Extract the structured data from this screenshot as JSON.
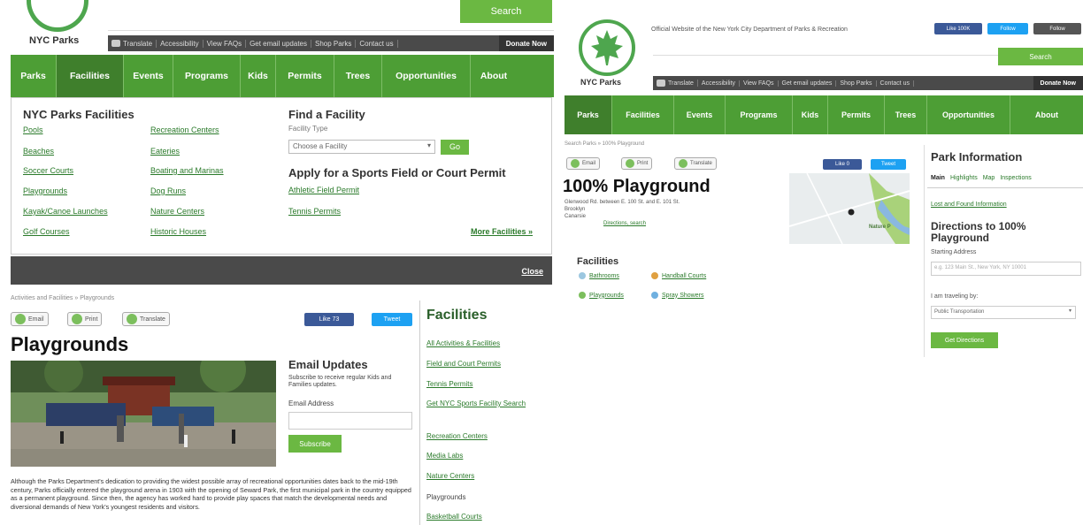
{
  "left": {
    "logo_text": "NYC Parks",
    "search_label": "Search",
    "util": {
      "translate": "Translate",
      "items": [
        "Accessibility",
        "View FAQs",
        "Get email updates",
        "Shop Parks",
        "Contact us"
      ],
      "donate": "Donate Now"
    },
    "nav": [
      "Parks",
      "Facilities",
      "Events",
      "Programs",
      "Kids",
      "Permits",
      "Trees",
      "Opportunities",
      "About"
    ],
    "dropdown": {
      "title": "NYC Parks Facilities",
      "col1": [
        "Pools",
        "Beaches",
        "Soccer Courts",
        "Playgrounds",
        "Kayak/Canoe Launches",
        "Golf Courses"
      ],
      "col2": [
        "Recreation Centers",
        "Eateries",
        "Boating and Marinas",
        "Dog Runs",
        "Nature Centers",
        "Historic Houses"
      ],
      "find_title": "Find a Facility",
      "facility_type_label": "Facility Type",
      "select_placeholder": "Choose a Facility",
      "go": "Go",
      "permit_title": "Apply for a Sports Field or Court Permit",
      "permit_links": [
        "Athletic Field Permit",
        "Tennis Permits"
      ],
      "more": "More Facilities »",
      "close": "Close"
    },
    "breadcrumb": "Activities and Facilities » Playgrounds",
    "share": {
      "email": "Email",
      "print": "Print",
      "translate": "Translate"
    },
    "like": "Like 73",
    "tweet": "Tweet",
    "page_title": "Playgrounds",
    "email_updates": {
      "title": "Email Updates",
      "desc": "Subscribe to receive regular Kids and Families updates.",
      "label": "Email Address",
      "button": "Subscribe"
    },
    "body_text": "Although the Parks Department's dedication to providing the widest possible array of recreational opportunities dates back to the mid-19th century, Parks officially entered the playground arena in 1903 with the opening of Seward Park, the first municipal park in the country equipped as a permanent playground. Since then, the agency has worked hard to provide play spaces that match the developmental needs and diversional demands of New York's youngest residents and visitors.",
    "sidebar": {
      "title": "Facilities",
      "links": [
        "All Activities & Facilities",
        "Field and Court Permits",
        "Tennis Permits",
        "Get NYC Sports Facility Search",
        "Recreation Centers",
        "Media Labs",
        "Nature Centers"
      ],
      "current": "Playgrounds",
      "after": [
        "Basketball Courts"
      ]
    }
  },
  "right": {
    "logo_text": "NYC Parks",
    "official": "Official Website of the New York City Department of Parks & Recreation",
    "social": [
      "Like 100K",
      "Follow",
      "Follow"
    ],
    "search_label": "Search",
    "util": {
      "translate": "Translate",
      "items": [
        "Accessibility",
        "View FAQs",
        "Get email updates",
        "Shop Parks",
        "Contact us"
      ],
      "donate": "Donate Now"
    },
    "nav": [
      "Parks",
      "Facilities",
      "Events",
      "Programs",
      "Kids",
      "Permits",
      "Trees",
      "Opportunities",
      "About"
    ],
    "breadcrumb": "Search Parks » 100% Playground",
    "share": {
      "email": "Email",
      "print": "Print",
      "translate": "Translate"
    },
    "like": "Like 0",
    "tweet": "Tweet",
    "page_title": "100% Playground",
    "address": [
      "Glenwood Rd. between E. 100 St. and E. 101 St.",
      "Brooklyn",
      "Canarsie"
    ],
    "zip_link": "Directions, search",
    "map_label": "Nature P",
    "facilities_title": "Facilities",
    "facilities": [
      "Bathrooms",
      "Handball Courts",
      "Playgrounds",
      "Spray Showers"
    ],
    "park_info": {
      "title": "Park Information",
      "tabs": [
        "Main",
        "Highlights",
        "Map",
        "Inspections"
      ],
      "link": "Lost and Found Information",
      "dir_title": "Directions to 100% Playground",
      "start_label": "Starting Address",
      "start_placeholder": "e.g. 123 Main St., New York, NY 10001",
      "travel_label": "I am traveling by:",
      "travel_value": "Public Transportation",
      "button": "Get Directions"
    }
  }
}
